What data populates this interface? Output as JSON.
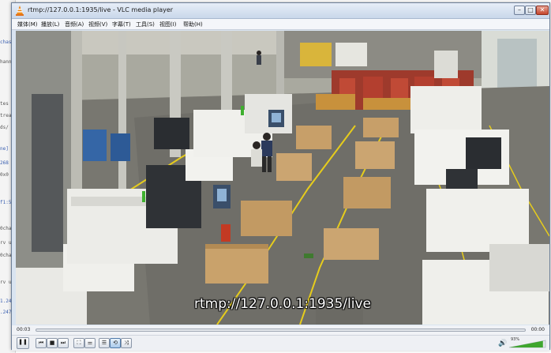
{
  "background_terminal": {
    "lines": [
      {
        "text": "chas",
        "blue": true
      },
      {
        "text": "hanne",
        "blue": false
      },
      {
        "text": "tes",
        "blue": false
      },
      {
        "text": "trea",
        "blue": false
      },
      {
        "text": "ds/",
        "blue": false
      },
      {
        "text": "ne]",
        "blue": true
      },
      {
        "text": "268",
        "blue": true
      },
      {
        "text": "0x0",
        "blue": false
      },
      {
        "text": "f1:5",
        "blue": true
      },
      {
        "text": "0cha",
        "blue": false
      },
      {
        "text": "rv u",
        "blue": false
      },
      {
        "text": "0cha",
        "blue": false
      },
      {
        "text": "rv u",
        "blue": false
      },
      {
        "text": "1.24",
        "blue": true
      },
      {
        "text": ".247",
        "blue": true
      }
    ]
  },
  "window": {
    "title": "rtmp://127.0.0.1:1935/live - VLC media player",
    "min_label": "–",
    "max_label": "□",
    "close_label": "✕"
  },
  "menu": [
    {
      "label": "媒体(M)"
    },
    {
      "label": "播放(L)"
    },
    {
      "label": "音频(A)"
    },
    {
      "label": "视频(V)"
    },
    {
      "label": "字幕(T)"
    },
    {
      "label": "工具(S)"
    },
    {
      "label": "视图(I)"
    },
    {
      "label": "帮助(H)"
    }
  ],
  "video": {
    "overlay_text": "rtmp://127.0.0.1:1935/live",
    "scene": "factory-floor-cnc-machines"
  },
  "playback": {
    "elapsed": "00:03",
    "duration": "00:00",
    "progress": 0.0
  },
  "controls": {
    "pause": "❚❚",
    "prev": "⏮",
    "stop": "■",
    "next": "⏭",
    "fullscreen": "⛶",
    "extended": "⚌",
    "playlist": "☰",
    "loop": "⟲",
    "random": "⤨"
  },
  "volume": {
    "percent_label": "93%",
    "level": 0.93,
    "icon": "speaker-icon"
  },
  "colors": {
    "accent": "#3f9a2f",
    "floor_line": "#f2d21a",
    "machine": "#ececec"
  }
}
